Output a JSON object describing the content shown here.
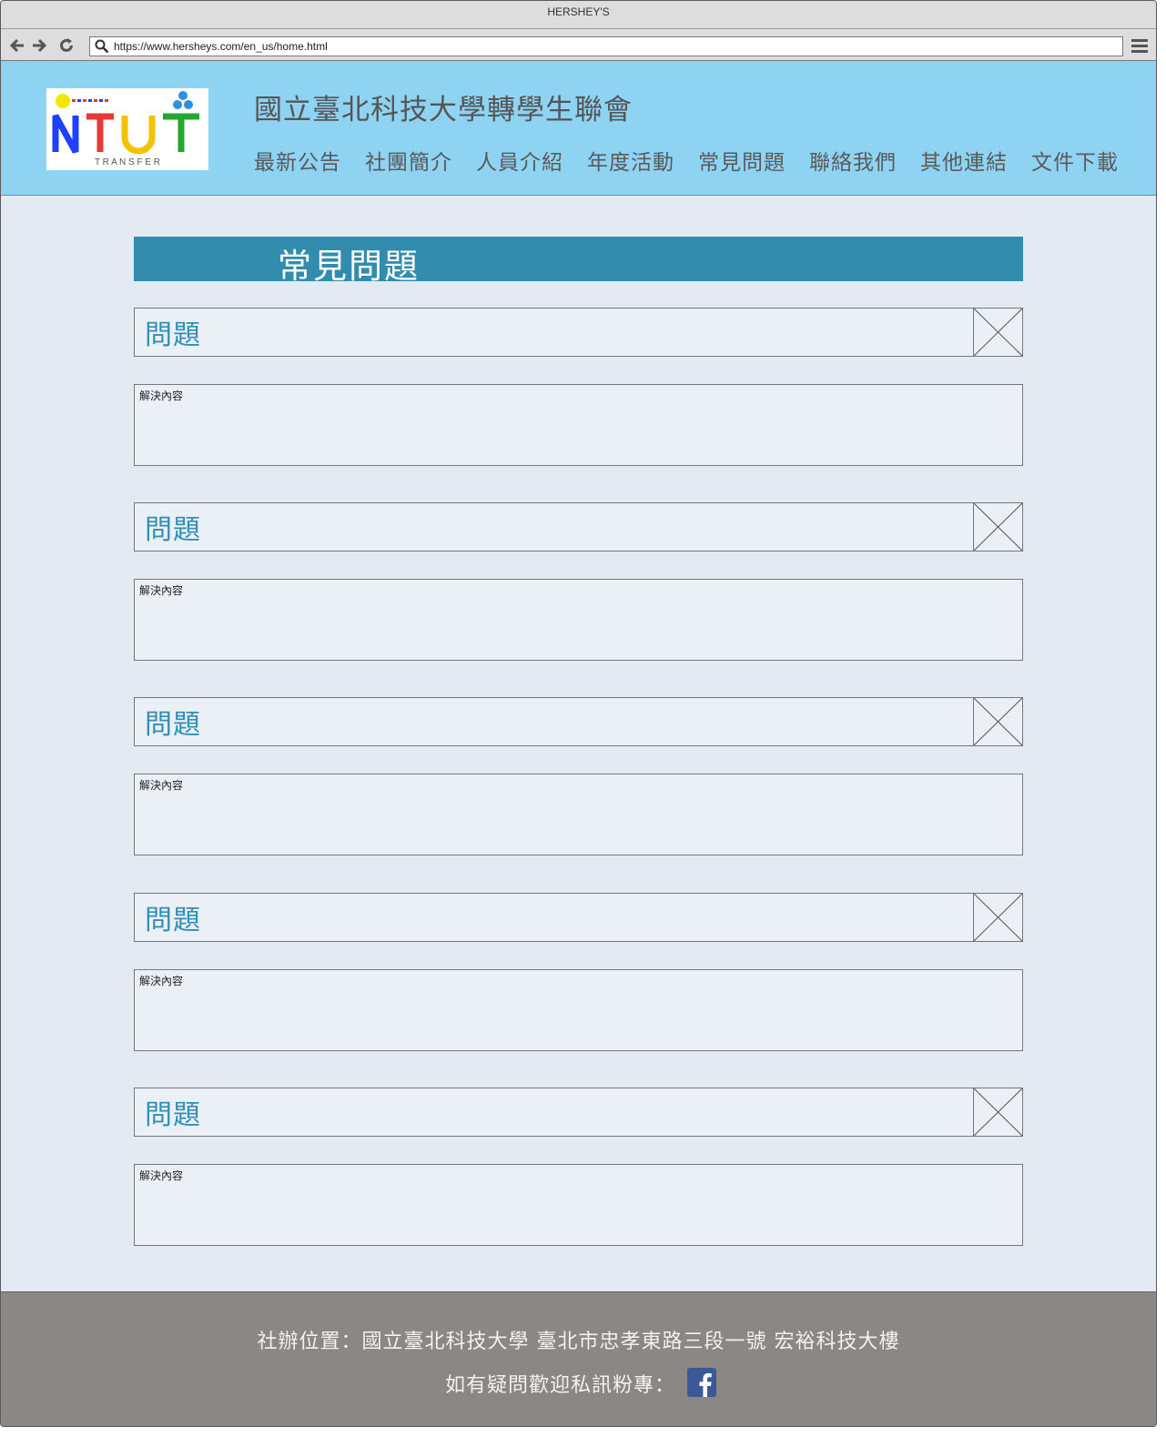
{
  "browser": {
    "window_title": "HERSHEY'S",
    "url": "https://www.hersheys.com/en_us/home.html"
  },
  "header": {
    "logo_text": "NTUT",
    "logo_subtext": "T R A N S F E R",
    "site_title": "國立臺北科技大學轉學生聯會",
    "nav": [
      {
        "label": "最新公告"
      },
      {
        "label": "社團簡介"
      },
      {
        "label": "人員介紹"
      },
      {
        "label": "年度活動"
      },
      {
        "label": "常見問題"
      },
      {
        "label": "聯絡我們"
      },
      {
        "label": "其他連結"
      },
      {
        "label": "文件下載"
      }
    ]
  },
  "main": {
    "heading": "常見問題",
    "faq": [
      {
        "question": "問題",
        "answer": "解決內容"
      },
      {
        "question": "問題",
        "answer": "解決內容"
      },
      {
        "question": "問題",
        "answer": "解決內容"
      },
      {
        "question": "問題",
        "answer": "解決內容"
      },
      {
        "question": "問題",
        "answer": "解決內容"
      }
    ]
  },
  "footer": {
    "location": "社辦位置：國立臺北科技大學  臺北市忠孝東路三段一號  宏裕科技大樓",
    "contact": "如有疑問歡迎私訊粉專："
  },
  "colors": {
    "header_bg": "#8fd3f3",
    "heading_bar": "#328cad",
    "question_text": "#2f8fb5",
    "footer_bg": "#8a8784",
    "facebook": "#3b5998"
  }
}
